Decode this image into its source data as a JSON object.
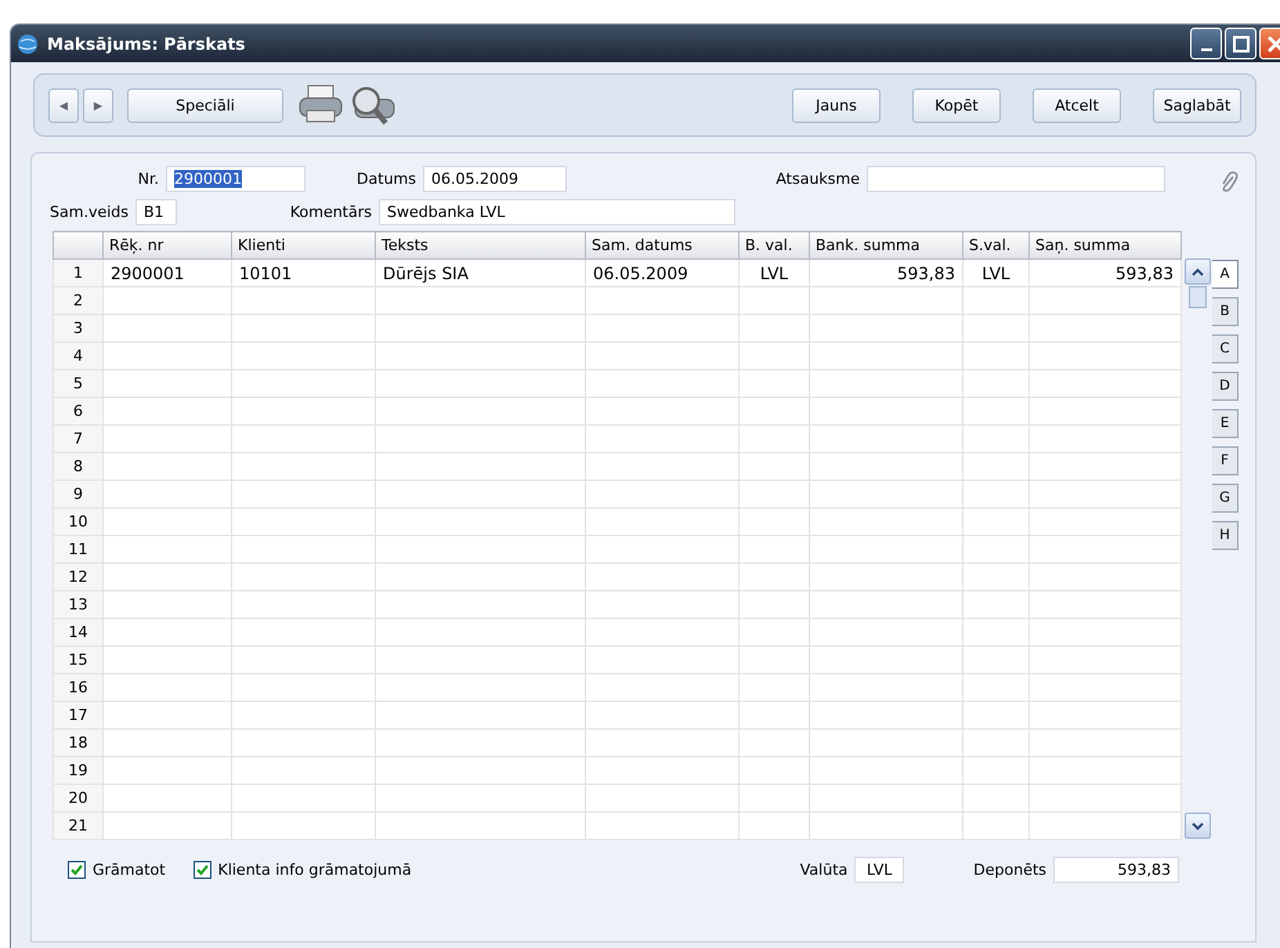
{
  "window": {
    "title": "Maksājums: Pārskats"
  },
  "toolbar": {
    "nav": [
      "◀",
      "▶"
    ],
    "special": "Speciāli",
    "actions": [
      "Jauns",
      "Kopēt",
      "Atcelt",
      "Saglabāt"
    ]
  },
  "header": {
    "nr": {
      "label": "Nr.",
      "value": "2900001",
      "highlighted": true
    },
    "date": {
      "label": "Datums",
      "value": "06.05.2009"
    },
    "reference": {
      "label": "Atsauksme"
    },
    "type": {
      "label": "Sam.veids",
      "value": "B1"
    },
    "comment": {
      "label": "Komentārs",
      "value": "Swedbanka LVL"
    }
  },
  "table": {
    "columns": [
      "Rēķ. nr",
      "Klienti",
      "Teksts",
      "Sam. datums",
      "B. val.",
      "Bank. summa",
      "S.val.",
      "Saņ. summa"
    ],
    "rows": [
      {
        "number": "1",
        "cells": [
          "2900001",
          "10101",
          "Dūrējs SIA",
          "06.05.2009",
          "LVL",
          "593,83",
          "LVL",
          "593,83"
        ]
      },
      {
        "number": "2"
      },
      {
        "number": "3"
      },
      {
        "number": "4"
      },
      {
        "number": "5"
      },
      {
        "number": "6"
      },
      {
        "number": "7"
      },
      {
        "number": "8"
      },
      {
        "number": "9"
      },
      {
        "number": "10"
      },
      {
        "number": "11"
      },
      {
        "number": "12"
      },
      {
        "number": "13"
      },
      {
        "number": "14"
      },
      {
        "number": "15"
      },
      {
        "number": "16"
      },
      {
        "number": "17"
      },
      {
        "number": "18"
      },
      {
        "number": "19"
      },
      {
        "number": "20"
      },
      {
        "number": "21"
      }
    ]
  },
  "side_tabs": [
    {
      "label": "A",
      "selected": true
    },
    {
      "label": "B",
      "selected": false
    },
    {
      "label": "C",
      "selected": false
    },
    {
      "label": "D",
      "selected": false
    },
    {
      "label": "E",
      "selected": false
    },
    {
      "label": "F",
      "selected": false
    },
    {
      "label": "G",
      "selected": false
    },
    {
      "label": "H",
      "selected": false
    }
  ],
  "footer": {
    "checkboxes": [
      {
        "label": "Grāmatot",
        "checked": true
      },
      {
        "label": "Klienta info grāmatojumā",
        "checked": true
      }
    ],
    "currency": {
      "label": "Valūta",
      "value": "LVL"
    },
    "deposited": {
      "label": "Deponēts",
      "value": "593,83"
    }
  }
}
